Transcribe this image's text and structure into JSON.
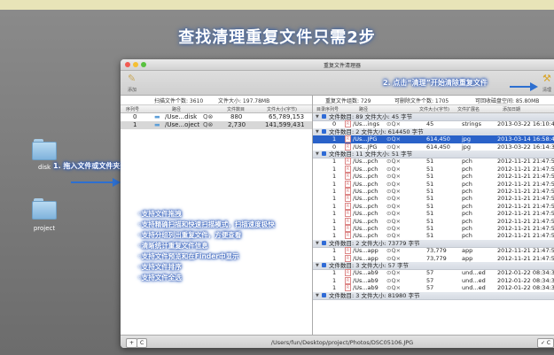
{
  "headline": "查找清理重复文件只需2步",
  "desktop": {
    "folders": [
      "disk",
      "project"
    ],
    "step1": "1. 拖入文件或文件夹开始扫描",
    "step2": "2. 点击“清理”开始清除重复文件"
  },
  "window": {
    "title": "重复文件清理器",
    "toolbar_left_label": "添加",
    "toolbar_right_label": "清理"
  },
  "left_pane": {
    "scanned_count": "扫描文件个数: 3610",
    "scanned_size": "文件大小: 197.78MB",
    "columns": [
      "序列号",
      "路径",
      "文件数目",
      "文件大小(字节)"
    ],
    "rows": [
      {
        "index": "0",
        "path": "/Use...disk",
        "count": "880",
        "size": "65,789,153"
      },
      {
        "index": "1",
        "path": "/Use...oject",
        "count": "2,730",
        "size": "141,599,431"
      }
    ]
  },
  "right_pane": {
    "groups_count": "重复文件组数: 729",
    "removable_count": "可删除文件个数: 1705",
    "recoverable": "可回收磁盘空间: 85.80MB",
    "columns": [
      "目录序列号",
      "路径",
      "文件大小(字节)",
      "文件扩展名",
      "添加日期"
    ],
    "rows": [
      {
        "kind": "group",
        "text": "文件数目: 89  文件大小: 45 字节"
      },
      {
        "kind": "file",
        "dir": "0",
        "path": "/Us...ings",
        "size": "45",
        "ext": "strings",
        "date": "2013-03-22 16:10:4"
      },
      {
        "kind": "group",
        "text": "文件数目: 2  文件大小: 614450 字节"
      },
      {
        "kind": "file",
        "sel": true,
        "dir": "1",
        "path": "/Us...JPG",
        "size": "614,450",
        "ext": "jpg",
        "date": "2013-03-14 16:58:4"
      },
      {
        "kind": "file",
        "dir": "0",
        "path": "/Us...JPG",
        "size": "614,450",
        "ext": "jpg",
        "date": "2013-03-22 16:14:3"
      },
      {
        "kind": "group",
        "text": "文件数目: 11  文件大小: 51 字节"
      },
      {
        "kind": "file",
        "dir": "1",
        "path": "/Us...pch",
        "size": "51",
        "ext": "pch",
        "date": "2012-11-21 21:47:5"
      },
      {
        "kind": "file",
        "dir": "1",
        "path": "/Us...pch",
        "size": "51",
        "ext": "pch",
        "date": "2012-11-21 21:47:5"
      },
      {
        "kind": "file",
        "dir": "1",
        "path": "/Us...pch",
        "size": "51",
        "ext": "pch",
        "date": "2012-11-21 21:47:5"
      },
      {
        "kind": "file",
        "dir": "1",
        "path": "/Us...pch",
        "size": "51",
        "ext": "pch",
        "date": "2012-11-21 21:47:5"
      },
      {
        "kind": "file",
        "dir": "1",
        "path": "/Us...pch",
        "size": "51",
        "ext": "pch",
        "date": "2012-11-21 21:47:5"
      },
      {
        "kind": "file",
        "dir": "1",
        "path": "/Us...pch",
        "size": "51",
        "ext": "pch",
        "date": "2012-11-21 21:47:5"
      },
      {
        "kind": "file",
        "dir": "1",
        "path": "/Us...pch",
        "size": "51",
        "ext": "pch",
        "date": "2012-11-21 21:47:5"
      },
      {
        "kind": "file",
        "dir": "1",
        "path": "/Us...pch",
        "size": "51",
        "ext": "pch",
        "date": "2012-11-21 21:47:5"
      },
      {
        "kind": "file",
        "dir": "1",
        "path": "/Us...pch",
        "size": "51",
        "ext": "pch",
        "date": "2012-11-21 21:47:5"
      },
      {
        "kind": "file",
        "dir": "1",
        "path": "/Us...pch",
        "size": "51",
        "ext": "pch",
        "date": "2012-11-21 21:47:5"
      },
      {
        "kind": "file",
        "dir": "1",
        "path": "/Us...pch",
        "size": "51",
        "ext": "pch",
        "date": "2012-11-21 21:47:5"
      },
      {
        "kind": "group",
        "text": "文件数目: 2  文件大小: 73779 字节"
      },
      {
        "kind": "file",
        "dir": "1",
        "path": "/Us...app",
        "size": "73,779",
        "ext": "app",
        "date": "2012-11-21 21:47:5"
      },
      {
        "kind": "file",
        "dir": "1",
        "path": "/Us...app",
        "size": "73,779",
        "ext": "app",
        "date": "2012-11-21 21:47:5"
      },
      {
        "kind": "group",
        "text": "文件数目: 3  文件大小: 57 字节"
      },
      {
        "kind": "file",
        "dir": "1",
        "path": "/Us...ab9",
        "size": "57",
        "ext": "und...ed",
        "date": "2012-01-22 08:34:3"
      },
      {
        "kind": "file",
        "dir": "1",
        "path": "/Us...ab9",
        "size": "57",
        "ext": "und...ed",
        "date": "2012-01-22 08:34:3"
      },
      {
        "kind": "file",
        "dir": "1",
        "path": "/Us...ab9",
        "size": "57",
        "ext": "und...ed",
        "date": "2012-01-22 08:34:3"
      },
      {
        "kind": "group",
        "text": "文件数目: 3  文件大小: 81980 字节"
      }
    ]
  },
  "features": [
    "支持文件拖拽",
    "支持精确扫描和快速扫描模式，扫描速度极快",
    "支持分组列出重复文件，方便查看",
    "清晰统计重复文件信息",
    "支持文件预览和在Finder中显示",
    "支持文件排序",
    "支持文件全选"
  ],
  "statusbar": {
    "path": "/Users/fun/Desktop/project/Photos/DSC05106.JPG",
    "add_btn": "+",
    "refresh_btn": "C",
    "confirm_btn": "✓ C"
  }
}
